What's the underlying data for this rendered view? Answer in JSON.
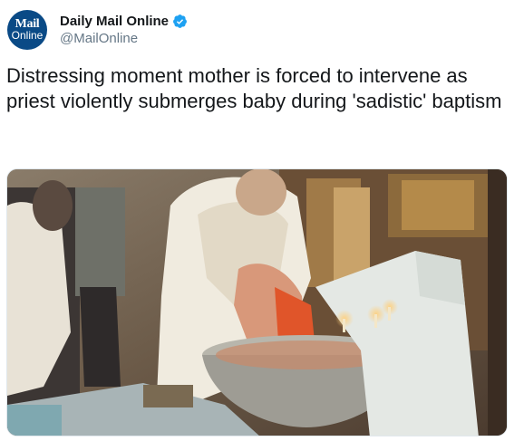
{
  "author": {
    "display_name": "Daily Mail Online",
    "handle": "@MailOnline",
    "avatar_text_line1": "Mail",
    "avatar_text_line2": "Online",
    "verified": true,
    "brand_color": "#0a4a86",
    "verified_color": "#1da1f2"
  },
  "tweet": {
    "text": "Distressing moment mother is forced to intervene as priest violently submerges baby during 'sadistic' baptism"
  },
  "media": {
    "type": "video-still",
    "icon": "video-thumbnail"
  }
}
